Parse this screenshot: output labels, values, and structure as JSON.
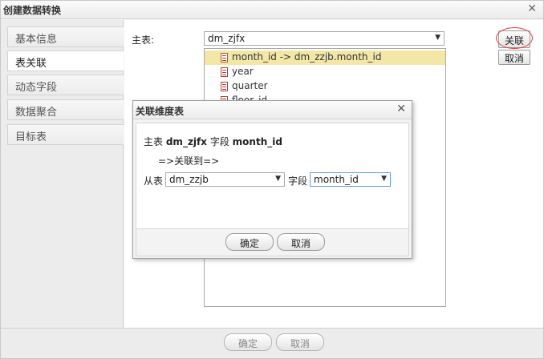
{
  "window": {
    "title": "创建数据转换"
  },
  "sidebar": {
    "tabs": [
      {
        "label": "基本信息"
      },
      {
        "label": "表关联"
      },
      {
        "label": "动态字段"
      },
      {
        "label": "数据聚合"
      },
      {
        "label": "目标表"
      }
    ],
    "active_index": 1
  },
  "main": {
    "main_table_label": "主表:",
    "main_table_value": "dm_zjfx",
    "fields": [
      {
        "label": "month_id -> dm_zzjb.month_id",
        "selected": true,
        "icon": "linked-field-icon"
      },
      {
        "label": "year",
        "selected": false,
        "icon": "field-icon"
      },
      {
        "label": "quarter",
        "selected": false,
        "icon": "field-icon"
      },
      {
        "label": "floor_id",
        "selected": false,
        "icon": "field-icon"
      }
    ],
    "link_button": "关联",
    "cancel_button": "取消"
  },
  "footer": {
    "confirm_button": "确定",
    "cancel_button": "取消"
  },
  "dialog": {
    "title": "关联维度表",
    "main_prefix": "主表",
    "main_table": "dm_zjfx",
    "field_word": "字段",
    "main_field": "month_id",
    "link_to": "=>关联到=>",
    "from_table_label": "从表",
    "from_table_value": "dm_zzjb",
    "field_label": "字段",
    "field_value": "month_id",
    "confirm_button": "确定",
    "cancel_button": "取消"
  },
  "colors": {
    "selected_row": "#f2e7a7",
    "highlight_circle": "#e04040",
    "field_icon": "#c0392b"
  }
}
